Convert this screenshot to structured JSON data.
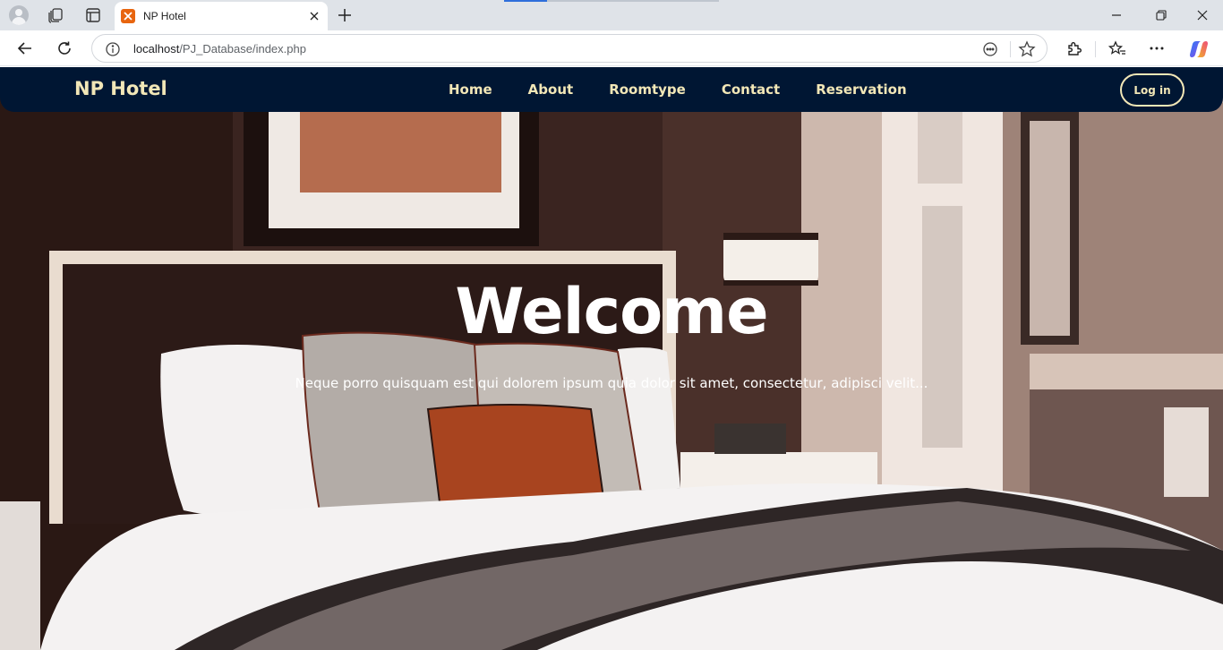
{
  "browser": {
    "tab_title": "NP Hotel",
    "url_host": "localhost",
    "url_path": "/PJ_Database/index.php",
    "icons": [
      "profile-icon",
      "workspaces-icon",
      "tab-actions-icon",
      "xampp-favicon",
      "close-icon",
      "new-tab-icon",
      "minimize-icon",
      "maximize-icon",
      "window-close-icon",
      "back-icon",
      "reload-icon",
      "info-icon",
      "reader-icon",
      "favorite-star-icon",
      "extensions-icon",
      "favorites-icon",
      "more-icon",
      "copilot-icon"
    ]
  },
  "navbar": {
    "brand": "NP Hotel",
    "links": [
      "Home",
      "About",
      "Roomtype",
      "Contact",
      "Reservation"
    ],
    "login_label": "Log in",
    "colors": {
      "background": "#001633",
      "text": "#f2e7b7"
    }
  },
  "hero": {
    "title": "Welcome",
    "subtitle": "Neque porro quisquam est qui dolorem ipsum quia dolor sit amet, consectetur, adipisci velit..."
  }
}
